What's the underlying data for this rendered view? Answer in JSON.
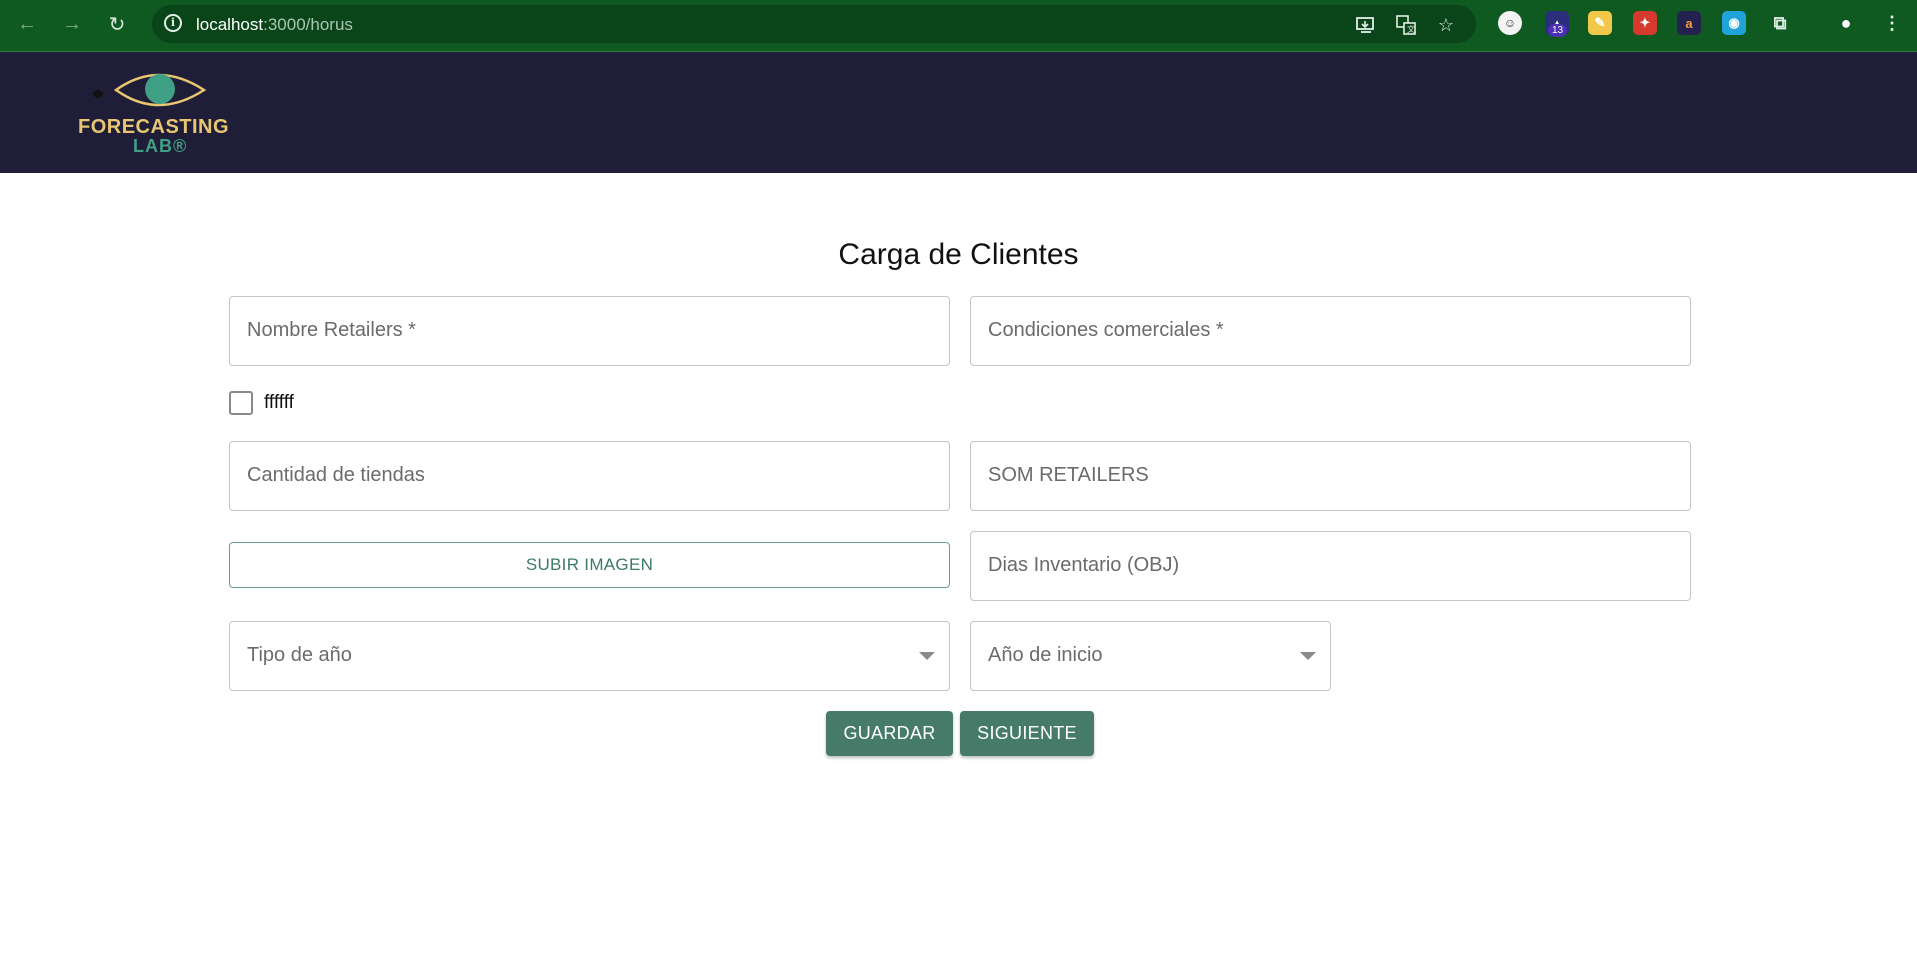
{
  "browser": {
    "url_host": "localhost",
    "url_rest": ":3000/horus",
    "extension_badge": "13"
  },
  "app": {
    "logo_line1": "FORECASTING",
    "logo_line2": "LAB®"
  },
  "form": {
    "title": "Carga de Clientes",
    "nombre_retailers_placeholder": "Nombre Retailers *",
    "condiciones_comerciales_placeholder": "Condiciones comerciales *",
    "checkbox_label": "ffffff",
    "checkbox_checked": false,
    "cantidad_tiendas_placeholder": "Cantidad de tiendas",
    "som_retailers_placeholder": "SOM RETAILERS",
    "subir_imagen_label": "SUBIR IMAGEN",
    "dias_inventario_placeholder": "Dias Inventario (OBJ)",
    "tipo_anio_placeholder": "Tipo de año",
    "anio_inicio_placeholder": "Año de inicio",
    "guardar_label": "GUARDAR",
    "siguiente_label": "SIGUIENTE"
  },
  "colors": {
    "browser_bar": "#0f5a21",
    "header_bg": "#1f1d37",
    "primary_green": "#467a69",
    "logo_gold": "#e8c671",
    "logo_teal": "#3fa085"
  }
}
